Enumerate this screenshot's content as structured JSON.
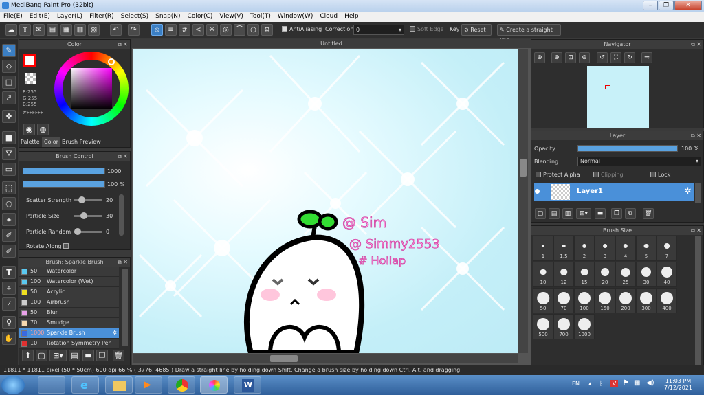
{
  "window": {
    "title": "MediBang Paint Pro (32bit)"
  },
  "menu": [
    "File(E)",
    "Edit(E)",
    "Layer(L)",
    "Filter(R)",
    "Select(S)",
    "Snap(N)",
    "Color(C)",
    "View(V)",
    "Tool(T)",
    "Window(W)",
    "Cloud",
    "Help"
  ],
  "toolbar": {
    "antialiasing": "AntiAliasing",
    "correction_label": "Correction",
    "correction_value": "0",
    "soft_edge": "Soft Edge",
    "key": "Key",
    "reset": "Reset",
    "straight_line": "Create a straight line"
  },
  "color_panel": {
    "title": "Color",
    "r": "R:255",
    "g": "G:255",
    "b": "B:255",
    "hex": "#FFFFFF",
    "tabs": [
      "Palette",
      "Color",
      "Brush Preview"
    ],
    "primary_color": "#ff0000"
  },
  "brush_control": {
    "title": "Brush Control",
    "size_value": "1000",
    "opacity_value": "100 %",
    "params": [
      {
        "label": "Scatter Strength",
        "value": "20",
        "level": 0.2
      },
      {
        "label": "Particle Size",
        "value": "30",
        "level": 0.3
      },
      {
        "label": "Particle Random",
        "value": "0",
        "level": 0.0
      }
    ],
    "rotate_along": "Rotate Along"
  },
  "brush_list": {
    "title": "Brush: Sparkle Brush",
    "items": [
      {
        "size": "50",
        "name": "Watercolor",
        "color": "#5ac8f0"
      },
      {
        "size": "100",
        "name": "Watercolor (Wet)",
        "color": "#5ac8f0"
      },
      {
        "size": "50",
        "name": "Acrylic",
        "color": "#f0e020"
      },
      {
        "size": "100",
        "name": "Airbrush",
        "color": "#cccccc"
      },
      {
        "size": "50",
        "name": "Blur",
        "color": "#e8a0e8"
      },
      {
        "size": "70",
        "name": "Smudge",
        "color": "#f5d8b0"
      },
      {
        "size": "1000",
        "name": "Sparkle Brush",
        "color": "#3a6ae0"
      },
      {
        "size": "10",
        "name": "Rotation Symmetry Pen",
        "color": "#e03030"
      }
    ]
  },
  "canvas": {
    "title": "Untitled",
    "text_lines": [
      "@ Sim",
      "@ Simmy2553",
      "# Hoilap"
    ]
  },
  "navigator": {
    "title": "Navigator"
  },
  "layer_panel": {
    "title": "Layer",
    "opacity_label": "Opacity",
    "opacity_value": "100 %",
    "opacity_level": 1.0,
    "blending_label": "Blending",
    "blending_value": "Normal",
    "protect_alpha": "Protect Alpha",
    "clipping": "Clipping",
    "lock": "Lock",
    "layer_name": "Layer1"
  },
  "brush_size": {
    "title": "Brush Size",
    "sizes": [
      "1",
      "1.5",
      "2",
      "3",
      "4",
      "5",
      "7",
      "10",
      "12",
      "15",
      "20",
      "25",
      "30",
      "40",
      "50",
      "70",
      "100",
      "150",
      "200",
      "300",
      "400",
      "500",
      "700",
      "1000"
    ]
  },
  "status": {
    "text": "11811 * 11811 pixel  (50 * 50cm)  600 dpi  66 %  ( 3776, 4685 )  Draw a straight line by holding down Shift, Change a brush size by holding down Ctrl, Alt, and dragging"
  },
  "taskbar": {
    "lang": "EN",
    "time": "11:03 PM",
    "date": "7/12/2021"
  }
}
